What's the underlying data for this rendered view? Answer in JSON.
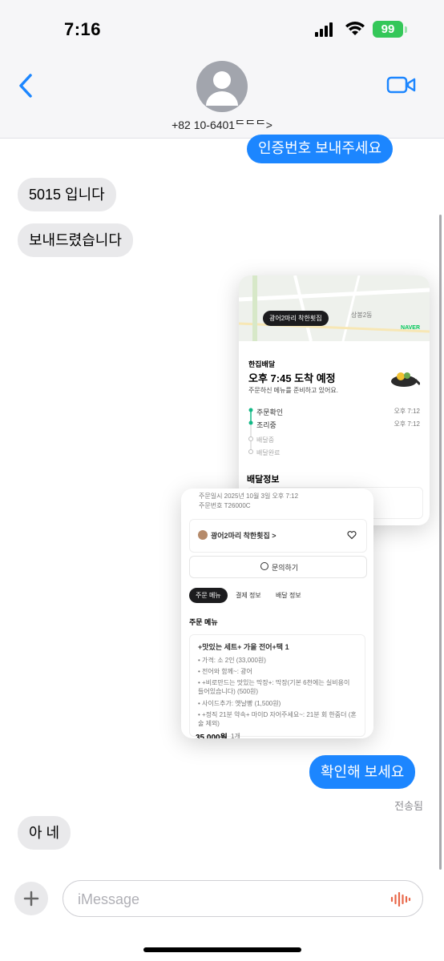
{
  "status_bar": {
    "time": "7:16",
    "battery": "99"
  },
  "header": {
    "contact": "+82 10-6401ᄃᄃᄃ>"
  },
  "messages": {
    "out1": "인증번호 보내주세요",
    "in1": "5015 입니다",
    "in2": "보내드렸습니다",
    "out2": "확인해 보세요",
    "delivered": "전송됨",
    "in3": "아 네"
  },
  "screenshot": {
    "map_pill": "광어2마리 착한횟집",
    "map_brand": "NAVER",
    "map_label": "상봉2동",
    "delivery_type": "한집배달",
    "eta": "오후 7:45 도착 예정",
    "eta_sub": "주문하신 메뉴를 준비하고 있어요.",
    "steps": [
      {
        "label": "주문확인",
        "time": "오후 7:12"
      },
      {
        "label": "조리중",
        "time": "오후 7:12"
      },
      {
        "label": "배달중",
        "time": ""
      },
      {
        "label": "배달완료",
        "time": ""
      }
    ],
    "delivery_info": "배달정보",
    "order_date": "주문일시 2025년 10월 3일 오후 7:12",
    "order_no": "주문번호 T26000C",
    "store": "광어2마리 착한횟집 >",
    "inquiry": "문의하기",
    "tabs": [
      "주문 메뉴",
      "결제 정보",
      "배달 정보"
    ],
    "section": "주문 메뉴",
    "menu_title": "+맛있는 세트+ 가을 전어+택 1",
    "menu_lines": [
      "• 가격: 소 2인 (33,000원)",
      "• 전어와 함께~: 광어",
      "• +비로만드는 맛있는 막장+: 막장(기본 6천에는 실비용이 들어있습니다) (500원)",
      "• 사이드추가: 옛날빵 (1,500원)",
      "• +정직 21분 약속+ 마이D 자어주세요~: 21분 회 한줌더 (혼술 제외)"
    ],
    "price": "35,000원",
    "qty": "1개"
  },
  "input": {
    "placeholder": "iMessage"
  },
  "colors": {
    "blue": "#1c86ff",
    "gray_bubble": "#e9e9eb",
    "battery": "#34c759"
  },
  "icons": [
    "back-chevron-icon",
    "avatar-icon",
    "video-camera-icon",
    "plus-icon",
    "audio-waveform-icon"
  ]
}
